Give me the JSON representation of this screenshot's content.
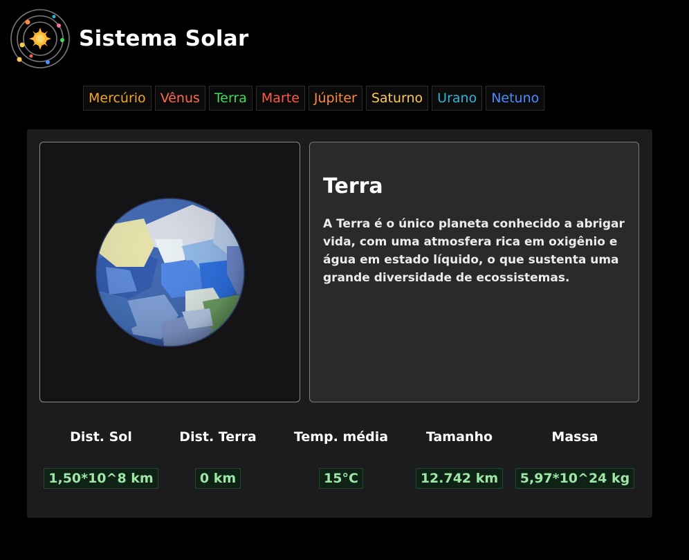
{
  "header": {
    "title": "Sistema Solar",
    "logo_icon": "solar-system-icon"
  },
  "nav": {
    "planets": [
      {
        "label": "Mercúrio",
        "color": "#f5a623"
      },
      {
        "label": "Vênus",
        "color": "#ff6a4d"
      },
      {
        "label": "Terra",
        "color": "#3ddc5a"
      },
      {
        "label": "Marte",
        "color": "#ff5a4a"
      },
      {
        "label": "Júpiter",
        "color": "#ff8a3d"
      },
      {
        "label": "Saturno",
        "color": "#ffc857"
      },
      {
        "label": "Urano",
        "color": "#2fb4d9"
      },
      {
        "label": "Netuno",
        "color": "#4b8cff"
      }
    ]
  },
  "planet": {
    "name": "Terra",
    "description": "A Terra é o único planeta conhecido a abrigar vida, com uma atmosfera rica em oxigênio e água em estado líquido, o que sustenta uma grande diversidade de ecossistemas.",
    "image_icon": "earth-planet-icon"
  },
  "stats": [
    {
      "label": "Dist. Sol",
      "value": "1,50*10^8 km"
    },
    {
      "label": "Dist. Terra",
      "value": "0 km"
    },
    {
      "label": "Temp. média",
      "value": "15°C"
    },
    {
      "label": "Tamanho",
      "value": "12.742 km"
    },
    {
      "label": "Massa",
      "value": "5,97*10^24 kg"
    }
  ],
  "colors": {
    "background": "#000000",
    "card": "#1c1c1e",
    "value_text": "#9ee6a6"
  }
}
